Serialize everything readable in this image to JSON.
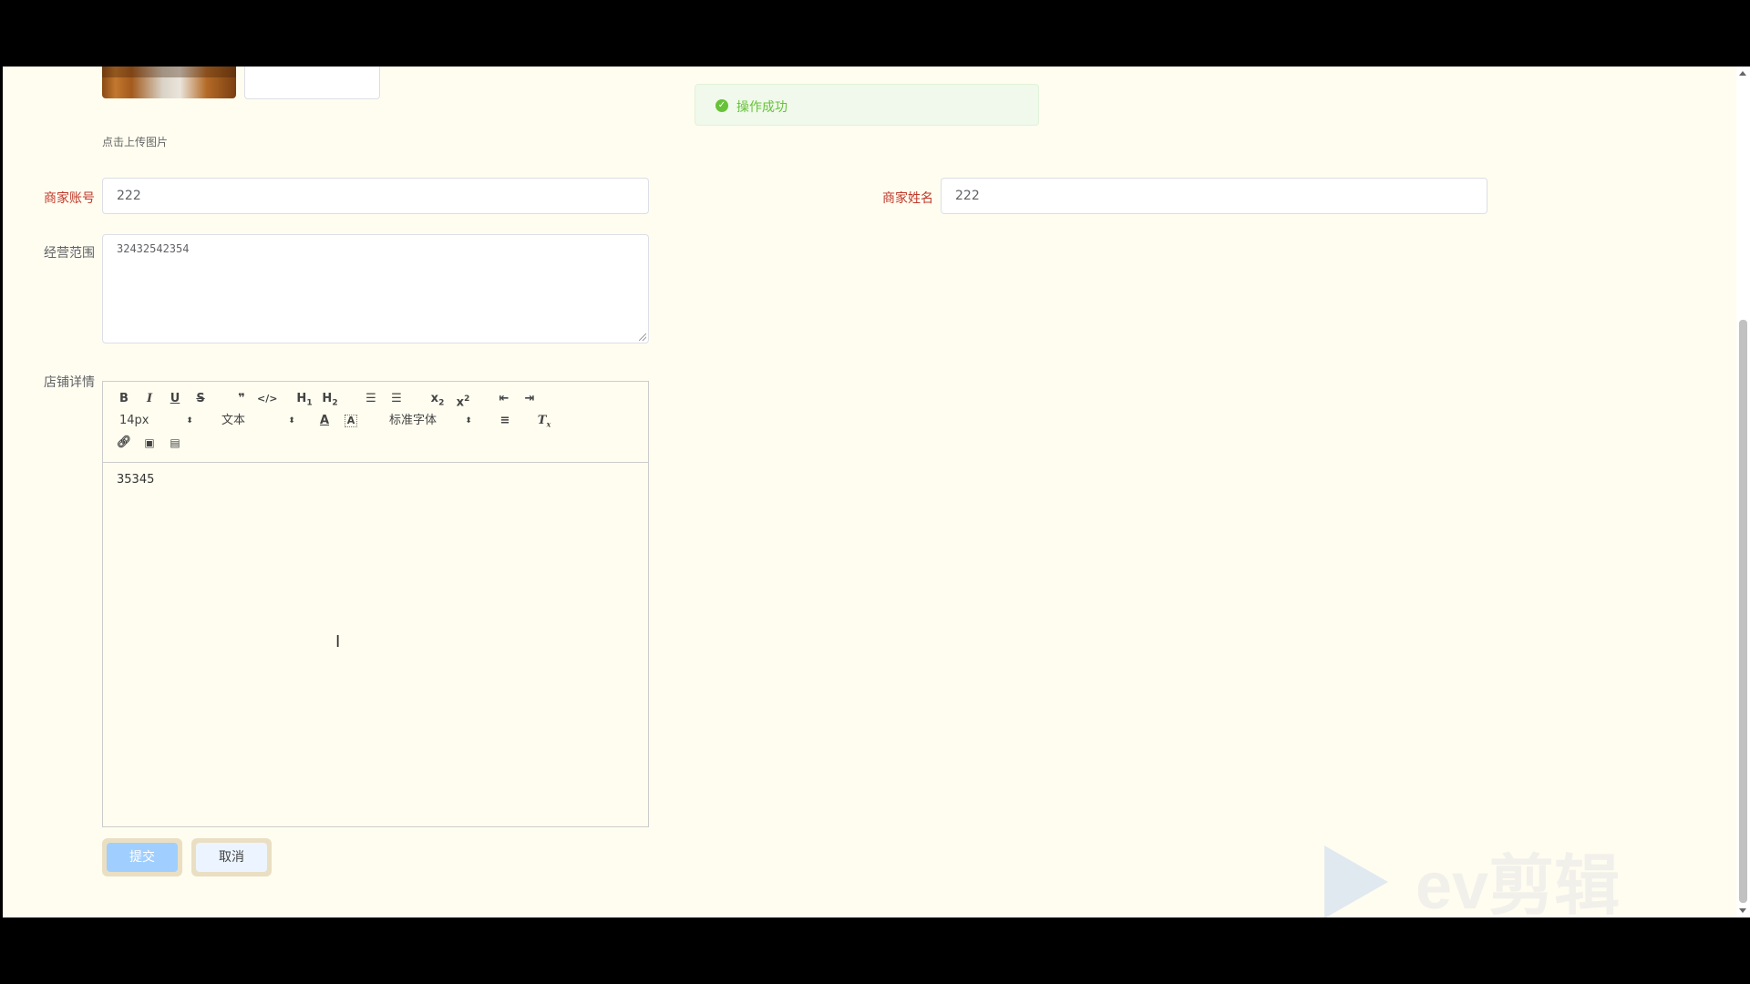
{
  "form": {
    "upload_hint": "点击上传图片",
    "account_label": "商家账号",
    "account_value": "222",
    "name_label": "商家姓名",
    "name_value": "222",
    "scope_label": "经营范围",
    "scope_value": "32432542354",
    "detail_label": "店铺详情",
    "detail_content": "35345",
    "submit_label": "提交",
    "cancel_label": "取消"
  },
  "toast": {
    "message": "操作成功",
    "type": "success"
  },
  "editor_toolbar": {
    "buttons_row1": [
      "bold-icon",
      "italic-icon",
      "underline-icon",
      "strike-icon",
      "quote-icon",
      "code-icon",
      "h1-icon",
      "h2-icon",
      "ordered-list-icon",
      "bullet-list-icon",
      "subscript-icon",
      "superscript-icon",
      "outdent-icon",
      "indent-icon"
    ],
    "font_size": "14px",
    "header_type": "文本",
    "font_family": "标准字体",
    "buttons_row3": [
      "link-icon",
      "image-icon",
      "video-icon"
    ]
  },
  "watermark": {
    "text": "ev剪辑"
  },
  "colors": {
    "page_bg": "#fffdf0",
    "required_label": "#c0392b",
    "success": "#67c23a",
    "primary_light": "#a0cfff"
  }
}
